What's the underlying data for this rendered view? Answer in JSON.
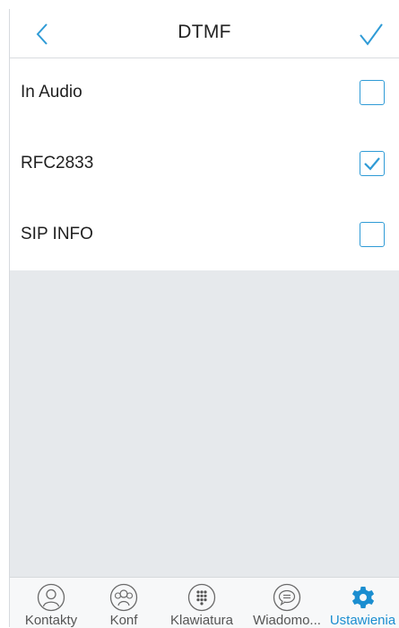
{
  "header": {
    "title": "DTMF",
    "back_icon": "chevron-left-icon",
    "confirm_icon": "checkmark-icon"
  },
  "options": [
    {
      "label": "In Audio",
      "checked": false
    },
    {
      "label": "RFC2833",
      "checked": true
    },
    {
      "label": "SIP INFO",
      "checked": false
    }
  ],
  "tabbar": {
    "tabs": [
      {
        "label": "Kontakty",
        "icon": "contact-icon",
        "active": false
      },
      {
        "label": "Konf",
        "icon": "conference-icon",
        "active": false
      },
      {
        "label": "Klawiatura",
        "icon": "dialpad-icon",
        "active": false
      },
      {
        "label": "Wiadomo...",
        "icon": "message-icon",
        "active": false
      },
      {
        "label": "Ustawienia",
        "icon": "gear-icon",
        "active": true
      }
    ]
  },
  "colors": {
    "accent": "#2f9bd6",
    "active_tab": "#1b8ed0",
    "background_gray": "#e6e9ec"
  }
}
